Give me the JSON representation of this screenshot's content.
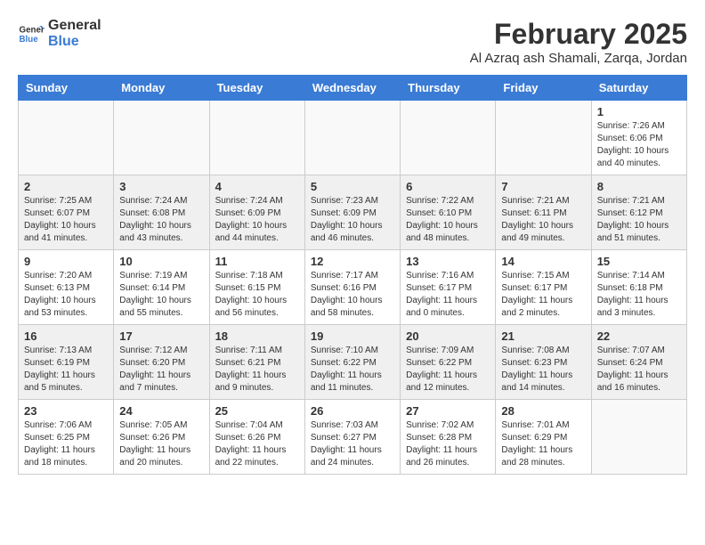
{
  "logo": {
    "general": "General",
    "blue": "Blue"
  },
  "title": "February 2025",
  "subtitle": "Al Azraq ash Shamali, Zarqa, Jordan",
  "days_of_week": [
    "Sunday",
    "Monday",
    "Tuesday",
    "Wednesday",
    "Thursday",
    "Friday",
    "Saturday"
  ],
  "weeks": [
    [
      {
        "day": "",
        "info": ""
      },
      {
        "day": "",
        "info": ""
      },
      {
        "day": "",
        "info": ""
      },
      {
        "day": "",
        "info": ""
      },
      {
        "day": "",
        "info": ""
      },
      {
        "day": "",
        "info": ""
      },
      {
        "day": "1",
        "info": "Sunrise: 7:26 AM\nSunset: 6:06 PM\nDaylight: 10 hours\nand 40 minutes."
      }
    ],
    [
      {
        "day": "2",
        "info": "Sunrise: 7:25 AM\nSunset: 6:07 PM\nDaylight: 10 hours\nand 41 minutes."
      },
      {
        "day": "3",
        "info": "Sunrise: 7:24 AM\nSunset: 6:08 PM\nDaylight: 10 hours\nand 43 minutes."
      },
      {
        "day": "4",
        "info": "Sunrise: 7:24 AM\nSunset: 6:09 PM\nDaylight: 10 hours\nand 44 minutes."
      },
      {
        "day": "5",
        "info": "Sunrise: 7:23 AM\nSunset: 6:09 PM\nDaylight: 10 hours\nand 46 minutes."
      },
      {
        "day": "6",
        "info": "Sunrise: 7:22 AM\nSunset: 6:10 PM\nDaylight: 10 hours\nand 48 minutes."
      },
      {
        "day": "7",
        "info": "Sunrise: 7:21 AM\nSunset: 6:11 PM\nDaylight: 10 hours\nand 49 minutes."
      },
      {
        "day": "8",
        "info": "Sunrise: 7:21 AM\nSunset: 6:12 PM\nDaylight: 10 hours\nand 51 minutes."
      }
    ],
    [
      {
        "day": "9",
        "info": "Sunrise: 7:20 AM\nSunset: 6:13 PM\nDaylight: 10 hours\nand 53 minutes."
      },
      {
        "day": "10",
        "info": "Sunrise: 7:19 AM\nSunset: 6:14 PM\nDaylight: 10 hours\nand 55 minutes."
      },
      {
        "day": "11",
        "info": "Sunrise: 7:18 AM\nSunset: 6:15 PM\nDaylight: 10 hours\nand 56 minutes."
      },
      {
        "day": "12",
        "info": "Sunrise: 7:17 AM\nSunset: 6:16 PM\nDaylight: 10 hours\nand 58 minutes."
      },
      {
        "day": "13",
        "info": "Sunrise: 7:16 AM\nSunset: 6:17 PM\nDaylight: 11 hours\nand 0 minutes."
      },
      {
        "day": "14",
        "info": "Sunrise: 7:15 AM\nSunset: 6:17 PM\nDaylight: 11 hours\nand 2 minutes."
      },
      {
        "day": "15",
        "info": "Sunrise: 7:14 AM\nSunset: 6:18 PM\nDaylight: 11 hours\nand 3 minutes."
      }
    ],
    [
      {
        "day": "16",
        "info": "Sunrise: 7:13 AM\nSunset: 6:19 PM\nDaylight: 11 hours\nand 5 minutes."
      },
      {
        "day": "17",
        "info": "Sunrise: 7:12 AM\nSunset: 6:20 PM\nDaylight: 11 hours\nand 7 minutes."
      },
      {
        "day": "18",
        "info": "Sunrise: 7:11 AM\nSunset: 6:21 PM\nDaylight: 11 hours\nand 9 minutes."
      },
      {
        "day": "19",
        "info": "Sunrise: 7:10 AM\nSunset: 6:22 PM\nDaylight: 11 hours\nand 11 minutes."
      },
      {
        "day": "20",
        "info": "Sunrise: 7:09 AM\nSunset: 6:22 PM\nDaylight: 11 hours\nand 12 minutes."
      },
      {
        "day": "21",
        "info": "Sunrise: 7:08 AM\nSunset: 6:23 PM\nDaylight: 11 hours\nand 14 minutes."
      },
      {
        "day": "22",
        "info": "Sunrise: 7:07 AM\nSunset: 6:24 PM\nDaylight: 11 hours\nand 16 minutes."
      }
    ],
    [
      {
        "day": "23",
        "info": "Sunrise: 7:06 AM\nSunset: 6:25 PM\nDaylight: 11 hours\nand 18 minutes."
      },
      {
        "day": "24",
        "info": "Sunrise: 7:05 AM\nSunset: 6:26 PM\nDaylight: 11 hours\nand 20 minutes."
      },
      {
        "day": "25",
        "info": "Sunrise: 7:04 AM\nSunset: 6:26 PM\nDaylight: 11 hours\nand 22 minutes."
      },
      {
        "day": "26",
        "info": "Sunrise: 7:03 AM\nSunset: 6:27 PM\nDaylight: 11 hours\nand 24 minutes."
      },
      {
        "day": "27",
        "info": "Sunrise: 7:02 AM\nSunset: 6:28 PM\nDaylight: 11 hours\nand 26 minutes."
      },
      {
        "day": "28",
        "info": "Sunrise: 7:01 AM\nSunset: 6:29 PM\nDaylight: 11 hours\nand 28 minutes."
      },
      {
        "day": "",
        "info": ""
      }
    ]
  ]
}
